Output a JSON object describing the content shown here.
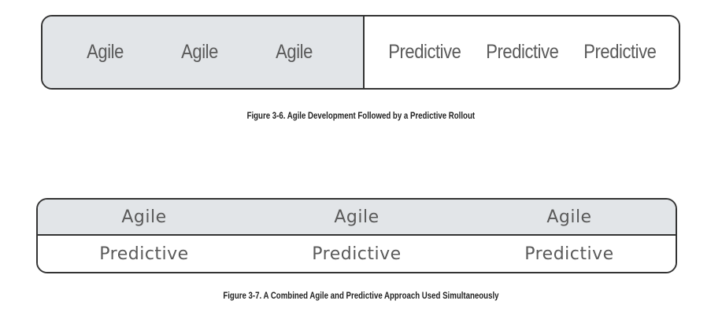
{
  "figure_3_6": {
    "agile_cells": [
      "Agile",
      "Agile",
      "Agile"
    ],
    "predictive_cells": [
      "Predictive",
      "Predictive",
      "Predictive"
    ],
    "caption": "Figure 3-6. Agile Development Followed by a Predictive Rollout"
  },
  "figure_3_7": {
    "agile_row": [
      "Agile",
      "Agile",
      "Agile"
    ],
    "predictive_row": [
      "Predictive",
      "Predictive",
      "Predictive"
    ],
    "caption": "Figure 3-7. A Combined Agile and Predictive Approach Used Simultaneously"
  },
  "colors": {
    "agile_fill": "#e2e5e8",
    "predictive_fill": "#ffffff",
    "border": "#333333",
    "text": "#5a5a5a"
  }
}
